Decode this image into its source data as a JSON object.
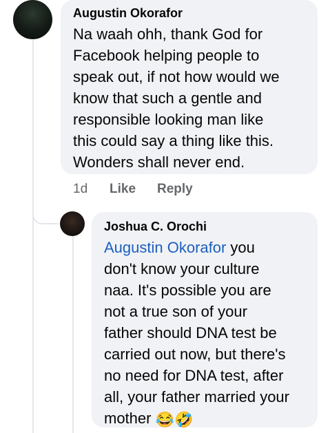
{
  "comment": {
    "author": "Augustin Okorafor",
    "text": "Na waah ohh, thank God for\nFacebook  helping people to\nspeak out, if not how would we\nknow that such a gentle and\nresponsible looking man like\nthis could say a thing like this.\nWonders shall never end.",
    "time": "1d",
    "like_label": "Like",
    "reply_label": "Reply"
  },
  "reply": {
    "author": "Joshua C. Orochi",
    "mention": "Augustin Okorafor",
    "text": " you\ndon't know your culture\nnaa. It's possible you are\nnot a true son of your\nfather should DNA test be\ncarried out now, but there's\nno need for DNA test, after\nall, your father married your\nmother ",
    "emojis": "😂🤣"
  }
}
